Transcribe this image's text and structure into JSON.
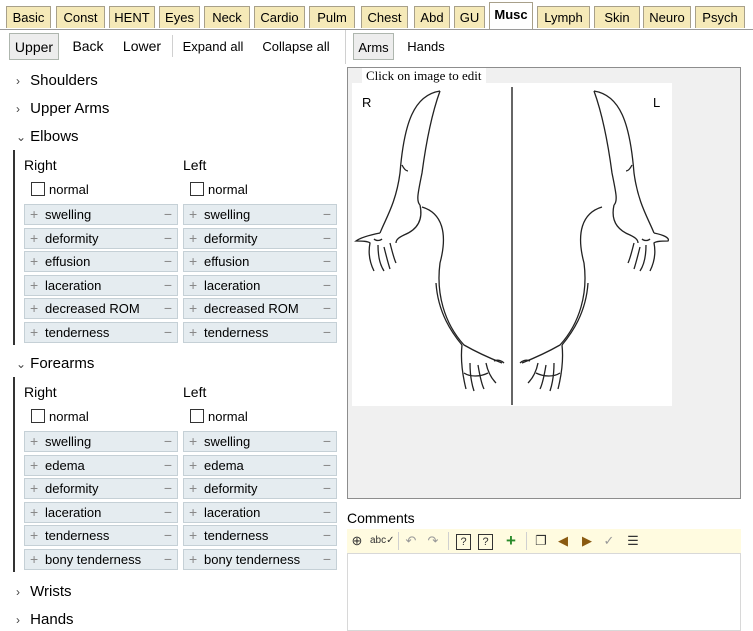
{
  "tabs": [
    "Basic",
    "Const",
    "HENT",
    "Eyes",
    "Neck",
    "Cardio",
    "Pulm",
    "Chest",
    "Abd",
    "GU",
    "Musc",
    "Lymph",
    "Skin",
    "Neuro",
    "Psych"
  ],
  "active_tab": "Musc",
  "left_toolbar": {
    "upper": "Upper",
    "back": "Back",
    "lower": "Lower",
    "expand_all": "Expand all",
    "collapse_all": "Collapse all"
  },
  "right_toolbar": {
    "arms": "Arms",
    "hands": "Hands"
  },
  "sections": {
    "shoulders": "Shoulders",
    "upper_arms": "Upper Arms",
    "elbows": "Elbows",
    "forearms": "Forearms",
    "wrists": "Wrists",
    "hands": "Hands"
  },
  "elbows": {
    "right_label": "Right",
    "left_label": "Left",
    "normal": "normal",
    "items": [
      "swelling",
      "deformity",
      "effusion",
      "laceration",
      "decreased ROM",
      "tenderness"
    ]
  },
  "forearms": {
    "right_label": "Right",
    "left_label": "Left",
    "normal": "normal",
    "items": [
      "swelling",
      "edema",
      "deformity",
      "laceration",
      "tenderness",
      "bony tenderness"
    ]
  },
  "image_panel": {
    "hint": "Click on image to edit",
    "right_marker": "R",
    "left_marker": "L"
  },
  "comments": {
    "label": "Comments"
  },
  "colors": {
    "tab_bg": "#f5e9b8",
    "item_bg": "#e5ecf0",
    "comment_toolbar_bg": "#fffbe0"
  }
}
